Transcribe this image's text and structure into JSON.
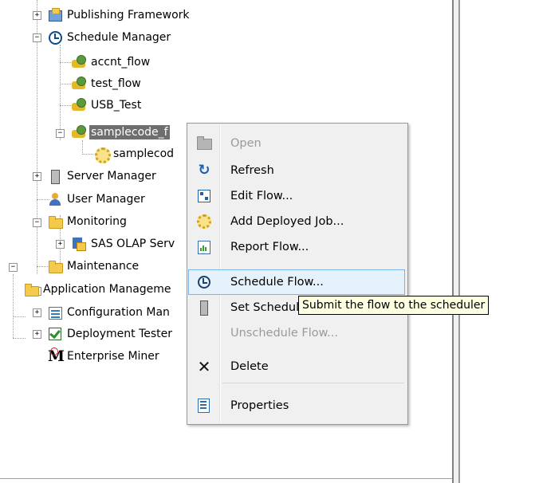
{
  "tree": {
    "items": [
      {
        "label": "Publishing Framework",
        "icon": "publishing-icon"
      },
      {
        "label": "Schedule Manager",
        "icon": "clock-icon"
      },
      {
        "label": "accnt_flow",
        "icon": "flow-icon"
      },
      {
        "label": "test_flow",
        "icon": "flow-icon"
      },
      {
        "label": "USB_Test",
        "icon": "flow-icon"
      },
      {
        "label": "samplecode_f",
        "icon": "flow-icon"
      },
      {
        "label": "samplecod",
        "icon": "job-gear-icon"
      },
      {
        "label": "Server Manager",
        "icon": "server-icon"
      },
      {
        "label": "User Manager",
        "icon": "user-icon"
      },
      {
        "label": "Monitoring",
        "icon": "folder-icon"
      },
      {
        "label": "SAS OLAP Serv",
        "icon": "olap-icon"
      },
      {
        "label": "Maintenance",
        "icon": "folder-icon"
      },
      {
        "label": "Application Manageme",
        "icon": "folder-icon"
      },
      {
        "label": "Configuration Man",
        "icon": "config-icon"
      },
      {
        "label": "Deployment Tester",
        "icon": "check-icon"
      },
      {
        "label": "Enterprise Miner",
        "icon": "enterprise-miner-icon"
      }
    ]
  },
  "context_menu": {
    "items": [
      {
        "label": "Open",
        "icon": "open-folder-icon",
        "disabled": true
      },
      {
        "label": "Refresh",
        "icon": "refresh-icon"
      },
      {
        "label": "Edit Flow...",
        "icon": "edit-flow-icon"
      },
      {
        "label": "Add Deployed Job...",
        "icon": "add-job-icon"
      },
      {
        "label": "Report Flow...",
        "icon": "report-icon"
      },
      {
        "label": "Schedule Flow...",
        "icon": "schedule-clock-icon",
        "highlighted": true
      },
      {
        "label": "Set Scheduling Server...",
        "icon": "server-icon"
      },
      {
        "label": "Unschedule Flow...",
        "icon": "none",
        "disabled": true
      },
      {
        "label": "Delete",
        "icon": "delete-x-icon"
      },
      {
        "label": "Properties",
        "icon": "properties-icon"
      }
    ]
  },
  "tooltip": {
    "text": "Submit the flow to the scheduler"
  },
  "colors": {
    "highlight_bg": "#e5f1fb",
    "highlight_border": "#7ab3e8",
    "tooltip_bg": "#ffffe1",
    "selected_node": "#6e6e6e"
  }
}
